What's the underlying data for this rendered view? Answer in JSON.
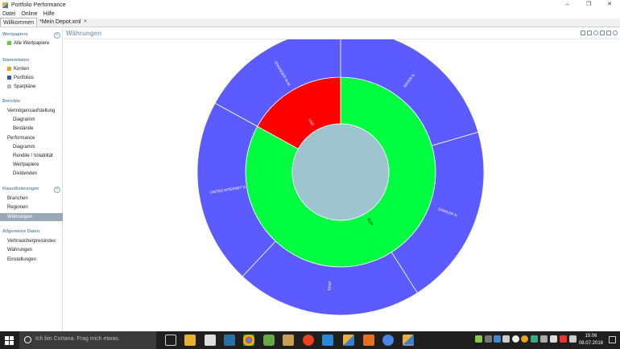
{
  "window": {
    "title": "Portfolio Performance",
    "controls": [
      "–",
      "❐",
      "✕"
    ]
  },
  "menu": [
    "Datei",
    "Online",
    "Hilfe"
  ],
  "tabs": [
    {
      "label": "Willkommen",
      "active": true
    },
    {
      "label": "*Mein Depot.xml",
      "active": false,
      "close": "✕"
    }
  ],
  "sidebar": {
    "wertpapiere": {
      "title": "Wertpapiere",
      "add": "+",
      "items": [
        "Alle Wertpapiere"
      ]
    },
    "stammdaten": {
      "title": "Stammdaten",
      "items": [
        "Konten",
        "Portfolios",
        "Sparpläne"
      ]
    },
    "berichte": {
      "title": "Berichte",
      "items": [
        "Vermögensaufstellung",
        "Diagramm",
        "Bestände",
        "Performance",
        "Diagramm",
        "Rendite / Volatilität",
        "Wertpapiere",
        "Dividenden"
      ]
    },
    "klassifizierungen": {
      "title": "Klassifizierungen",
      "add": "+",
      "items": [
        "Branchen",
        "Regionen",
        "Währungen"
      ],
      "selected": "Währungen"
    },
    "allgemein": {
      "title": "Allgemeine Daten",
      "items": [
        "Verbraucherpreisindex",
        "Währungen",
        "Einstellungen"
      ]
    }
  },
  "main": {
    "title": "Währungen"
  },
  "chart_data": {
    "type": "sunburst",
    "inner_ring": [
      {
        "label": "EUR",
        "value": 83,
        "color": "#00ff40"
      },
      {
        "label": "USD",
        "value": 17,
        "color": "#ff0000"
      }
    ],
    "outer_ring": [
      {
        "label": "BAYER N",
        "parent": "EUR",
        "value": 20.5,
        "color": "#5b5bff"
      },
      {
        "label": "DAIMLER N",
        "parent": "EUR",
        "value": 20.5,
        "color": "#5b5bff"
      },
      {
        "label": "BASF",
        "parent": "EUR",
        "value": 21,
        "color": "#5b5bff"
      },
      {
        "label": "UNITED INTERNET N",
        "parent": "EUR",
        "value": 21,
        "color": "#5b5bff"
      },
      {
        "label": "GRAINGER W.W.",
        "parent": "USD",
        "value": 17,
        "color": "#5b5bff"
      }
    ],
    "center_color": "#9dc4cf"
  },
  "taskbar": {
    "search_placeholder": "Ich bin Cortana. Frag mich etwas.",
    "time": "15:06",
    "date": "08.07.2016"
  }
}
